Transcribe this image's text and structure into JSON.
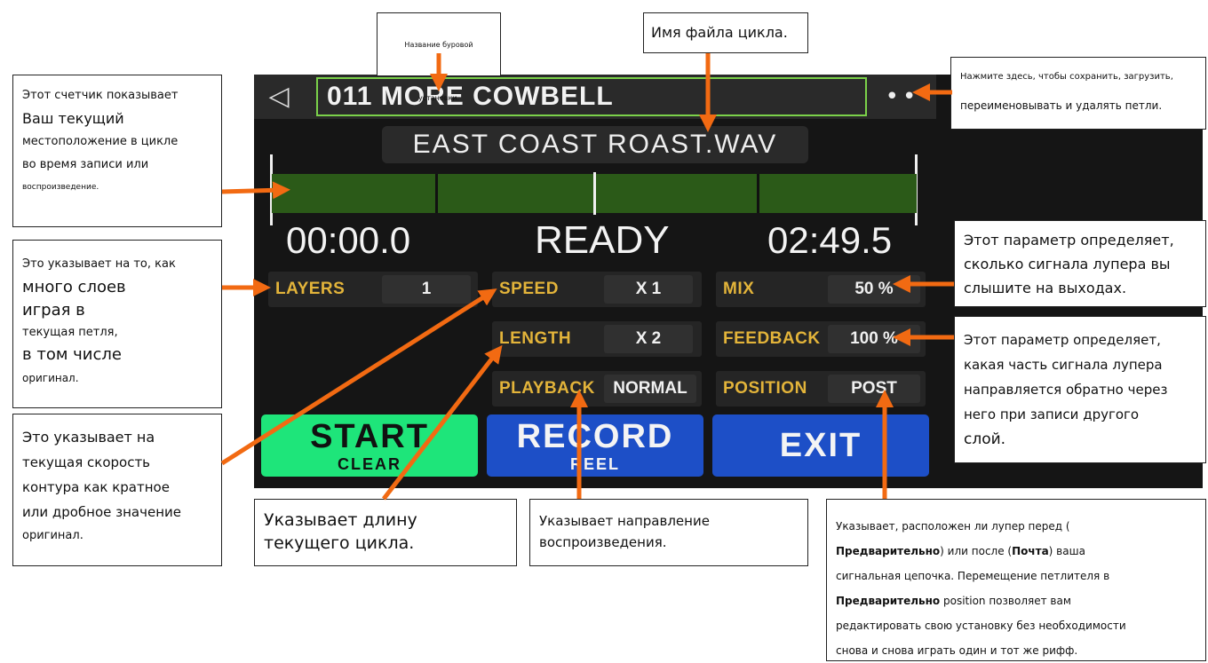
{
  "device": {
    "setup_name": "011 MORE COWBELL",
    "filename": "EAST COAST ROAST.WAV",
    "time_current": "00:00.0",
    "status": "READY",
    "time_total": "02:49.5",
    "progress": 0.0,
    "params": {
      "layers_label": "LAYERS",
      "layers_value": "1",
      "speed_label": "SPEED",
      "speed_value": "X 1",
      "length_label": "LENGTH",
      "length_value": "X 2",
      "playback_label": "PLAYBACK",
      "playback_value": "NORMAL",
      "mix_label": "MIX",
      "mix_value": "50 %",
      "feedback_label": "FEEDBACK",
      "feedback_value": "100 %",
      "position_label": "POSITION",
      "position_value": "POST"
    },
    "buttons": {
      "start_main": "START",
      "start_sub": "CLEAR",
      "record_main": "RECORD",
      "record_sub": "REEL",
      "exit_main": "EXIT"
    },
    "colors": {
      "start": "#1ee57a",
      "record": "#1d4fc7",
      "exit": "#1d4fc7",
      "accent": "#e3b43a",
      "arrow": "#f26a12",
      "progress": "#2b5a18",
      "outline": "#7bd14a"
    }
  },
  "callouts": {
    "setup_name": "Название буровой установки.",
    "loop_filename": "Имя файла цикла.",
    "save_menu_1": "Нажмите здесь, чтобы сохранить, загрузить,",
    "save_menu_2": "переименовывать и удалять петли.",
    "counter_1": "Этот счетчик показывает",
    "counter_2": "Ваш текущий",
    "counter_3": "местоположение в цикле",
    "counter_4": "во время записи или",
    "counter_5": "воспроизведение.",
    "layers_1": "Это указывает на то, как",
    "layers_2": "много слоев",
    "layers_3": "играя в",
    "layers_4": "текущая петля,",
    "layers_5": "в том числе",
    "layers_6": "оригинал.",
    "speed_1": "Это указывает на",
    "speed_2": "текущая скорость",
    "speed_3": "контура как кратное",
    "speed_4": "или дробное значение",
    "speed_5": "оригинал.",
    "length_1": "Указывает длину",
    "length_2": "текущего цикла.",
    "playback_1": "Указывает направление",
    "playback_2": "воспроизведения.",
    "mix_1": "Этот параметр определяет,",
    "mix_2": "сколько сигнала лупера вы",
    "mix_3": "слышите на выходах.",
    "feedback_1": "Этот параметр определяет,",
    "feedback_2": "какая часть сигнала лупера",
    "feedback_3": "направляется обратно через",
    "feedback_4": "него при записи другого",
    "feedback_5": "слой.",
    "position_1a": "Указывает, расположен ли лупер перед (",
    "position_pre": "Предварительно",
    "position_1b": ") или после (",
    "position_post": "Почта",
    "position_1c": ") ваша",
    "position_2": "сигнальная цепочка. Перемещение петлителя в",
    "position_3b": " position позволяет вам",
    "position_4": "редактировать свою установку без необходимости",
    "position_5": "снова и снова играть один и тот же рифф."
  }
}
